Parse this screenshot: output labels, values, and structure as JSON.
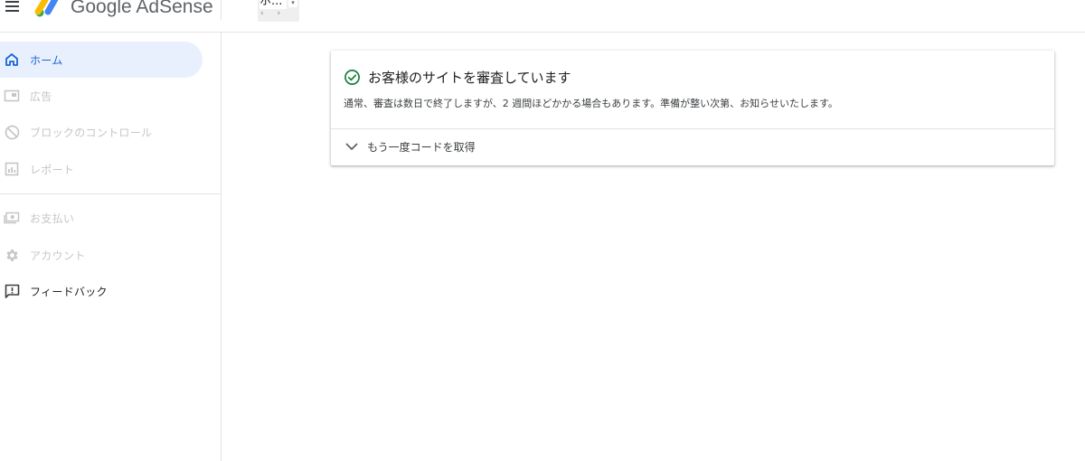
{
  "header": {
    "brand": "Google AdSense",
    "site_name": "ホ...",
    "site_dropdown_glyph": "▾",
    "site_nav_arrows": "‹ ›"
  },
  "sidebar": {
    "items": [
      {
        "label": "ホーム",
        "icon": "home-icon",
        "state": "active"
      },
      {
        "label": "広告",
        "icon": "ads-icon",
        "state": "disabled"
      },
      {
        "label": "ブロックのコントロール",
        "icon": "block-icon",
        "state": "disabled"
      },
      {
        "label": "レポート",
        "icon": "reports-icon",
        "state": "disabled"
      },
      {
        "label": "お支払い",
        "icon": "payments-icon",
        "state": "disabled"
      },
      {
        "label": "アカウント",
        "icon": "gear-icon",
        "state": "disabled"
      },
      {
        "label": "フィードバック",
        "icon": "feedback-icon",
        "state": "normal"
      }
    ]
  },
  "card": {
    "title": "お客様のサイトを審査しています",
    "body": "通常、審査は数日で終了しますが、2 週間ほどかかる場合もあります。準備が整い次第、お知らせいたします。",
    "expand_label": "もう一度コードを取得"
  },
  "colors": {
    "accent": "#1967d2",
    "active_bg": "#e8f0fe",
    "success": "#188038",
    "disabled": "#c4c7c5"
  }
}
